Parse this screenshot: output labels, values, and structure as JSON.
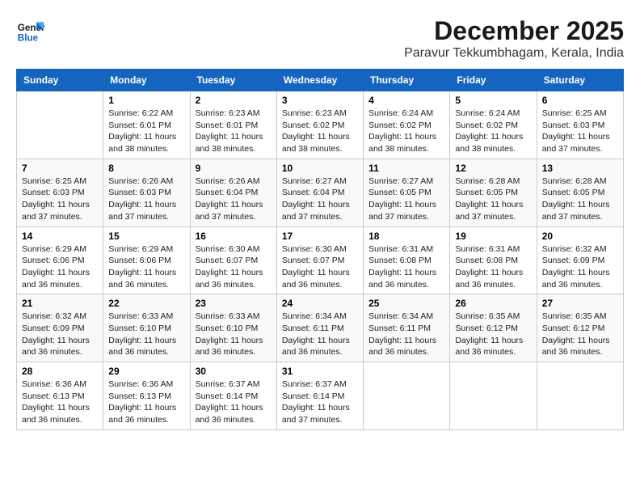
{
  "header": {
    "logo_general": "General",
    "logo_blue": "Blue",
    "month": "December 2025",
    "location": "Paravur Tekkumbhagam, Kerala, India"
  },
  "columns": [
    "Sunday",
    "Monday",
    "Tuesday",
    "Wednesday",
    "Thursday",
    "Friday",
    "Saturday"
  ],
  "weeks": [
    [
      {
        "day": "",
        "info": ""
      },
      {
        "day": "1",
        "info": "Sunrise: 6:22 AM\nSunset: 6:01 PM\nDaylight: 11 hours\nand 38 minutes."
      },
      {
        "day": "2",
        "info": "Sunrise: 6:23 AM\nSunset: 6:01 PM\nDaylight: 11 hours\nand 38 minutes."
      },
      {
        "day": "3",
        "info": "Sunrise: 6:23 AM\nSunset: 6:02 PM\nDaylight: 11 hours\nand 38 minutes."
      },
      {
        "day": "4",
        "info": "Sunrise: 6:24 AM\nSunset: 6:02 PM\nDaylight: 11 hours\nand 38 minutes."
      },
      {
        "day": "5",
        "info": "Sunrise: 6:24 AM\nSunset: 6:02 PM\nDaylight: 11 hours\nand 38 minutes."
      },
      {
        "day": "6",
        "info": "Sunrise: 6:25 AM\nSunset: 6:03 PM\nDaylight: 11 hours\nand 37 minutes."
      }
    ],
    [
      {
        "day": "7",
        "info": "Sunrise: 6:25 AM\nSunset: 6:03 PM\nDaylight: 11 hours\nand 37 minutes."
      },
      {
        "day": "8",
        "info": "Sunrise: 6:26 AM\nSunset: 6:03 PM\nDaylight: 11 hours\nand 37 minutes."
      },
      {
        "day": "9",
        "info": "Sunrise: 6:26 AM\nSunset: 6:04 PM\nDaylight: 11 hours\nand 37 minutes."
      },
      {
        "day": "10",
        "info": "Sunrise: 6:27 AM\nSunset: 6:04 PM\nDaylight: 11 hours\nand 37 minutes."
      },
      {
        "day": "11",
        "info": "Sunrise: 6:27 AM\nSunset: 6:05 PM\nDaylight: 11 hours\nand 37 minutes."
      },
      {
        "day": "12",
        "info": "Sunrise: 6:28 AM\nSunset: 6:05 PM\nDaylight: 11 hours\nand 37 minutes."
      },
      {
        "day": "13",
        "info": "Sunrise: 6:28 AM\nSunset: 6:05 PM\nDaylight: 11 hours\nand 37 minutes."
      }
    ],
    [
      {
        "day": "14",
        "info": "Sunrise: 6:29 AM\nSunset: 6:06 PM\nDaylight: 11 hours\nand 36 minutes."
      },
      {
        "day": "15",
        "info": "Sunrise: 6:29 AM\nSunset: 6:06 PM\nDaylight: 11 hours\nand 36 minutes."
      },
      {
        "day": "16",
        "info": "Sunrise: 6:30 AM\nSunset: 6:07 PM\nDaylight: 11 hours\nand 36 minutes."
      },
      {
        "day": "17",
        "info": "Sunrise: 6:30 AM\nSunset: 6:07 PM\nDaylight: 11 hours\nand 36 minutes."
      },
      {
        "day": "18",
        "info": "Sunrise: 6:31 AM\nSunset: 6:08 PM\nDaylight: 11 hours\nand 36 minutes."
      },
      {
        "day": "19",
        "info": "Sunrise: 6:31 AM\nSunset: 6:08 PM\nDaylight: 11 hours\nand 36 minutes."
      },
      {
        "day": "20",
        "info": "Sunrise: 6:32 AM\nSunset: 6:09 PM\nDaylight: 11 hours\nand 36 minutes."
      }
    ],
    [
      {
        "day": "21",
        "info": "Sunrise: 6:32 AM\nSunset: 6:09 PM\nDaylight: 11 hours\nand 36 minutes."
      },
      {
        "day": "22",
        "info": "Sunrise: 6:33 AM\nSunset: 6:10 PM\nDaylight: 11 hours\nand 36 minutes."
      },
      {
        "day": "23",
        "info": "Sunrise: 6:33 AM\nSunset: 6:10 PM\nDaylight: 11 hours\nand 36 minutes."
      },
      {
        "day": "24",
        "info": "Sunrise: 6:34 AM\nSunset: 6:11 PM\nDaylight: 11 hours\nand 36 minutes."
      },
      {
        "day": "25",
        "info": "Sunrise: 6:34 AM\nSunset: 6:11 PM\nDaylight: 11 hours\nand 36 minutes."
      },
      {
        "day": "26",
        "info": "Sunrise: 6:35 AM\nSunset: 6:12 PM\nDaylight: 11 hours\nand 36 minutes."
      },
      {
        "day": "27",
        "info": "Sunrise: 6:35 AM\nSunset: 6:12 PM\nDaylight: 11 hours\nand 36 minutes."
      }
    ],
    [
      {
        "day": "28",
        "info": "Sunrise: 6:36 AM\nSunset: 6:13 PM\nDaylight: 11 hours\nand 36 minutes."
      },
      {
        "day": "29",
        "info": "Sunrise: 6:36 AM\nSunset: 6:13 PM\nDaylight: 11 hours\nand 36 minutes."
      },
      {
        "day": "30",
        "info": "Sunrise: 6:37 AM\nSunset: 6:14 PM\nDaylight: 11 hours\nand 36 minutes."
      },
      {
        "day": "31",
        "info": "Sunrise: 6:37 AM\nSunset: 6:14 PM\nDaylight: 11 hours\nand 37 minutes."
      },
      {
        "day": "",
        "info": ""
      },
      {
        "day": "",
        "info": ""
      },
      {
        "day": "",
        "info": ""
      }
    ]
  ]
}
